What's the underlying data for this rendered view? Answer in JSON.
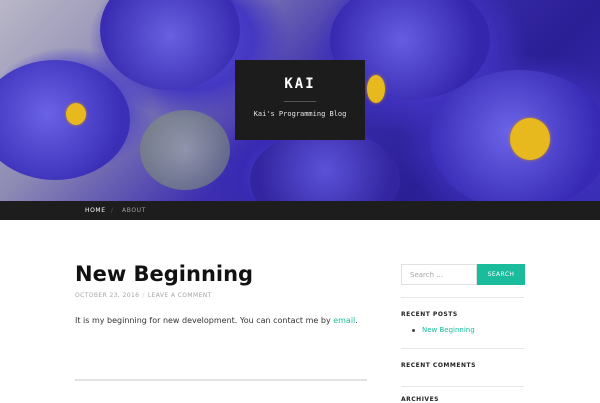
{
  "site": {
    "title": "KAI",
    "description": "Kai's Programming Blog"
  },
  "nav": {
    "items": [
      {
        "label": "HOME"
      },
      {
        "label": "ABOUT"
      }
    ],
    "separator": "/"
  },
  "post": {
    "title": "New Beginning",
    "date": "OCTOBER 23, 2016",
    "meta_separator": "/",
    "comment_link": "LEAVE A COMMENT",
    "body_text": "It is my beginning for new development. You can contact me by ",
    "body_link": "email",
    "body_end": "."
  },
  "sidebar": {
    "search_placeholder": "Search ...",
    "search_button": "SEARCH",
    "recent_posts_title": "RECENT POSTS",
    "recent_posts": [
      "New Beginning"
    ],
    "recent_comments_title": "RECENT COMMENTS",
    "archives_title": "ARCHIVES"
  },
  "colors": {
    "accent": "#1abc9c",
    "nav_bg": "#1d1d1d",
    "title_box_bg": "#1c1c1c"
  }
}
